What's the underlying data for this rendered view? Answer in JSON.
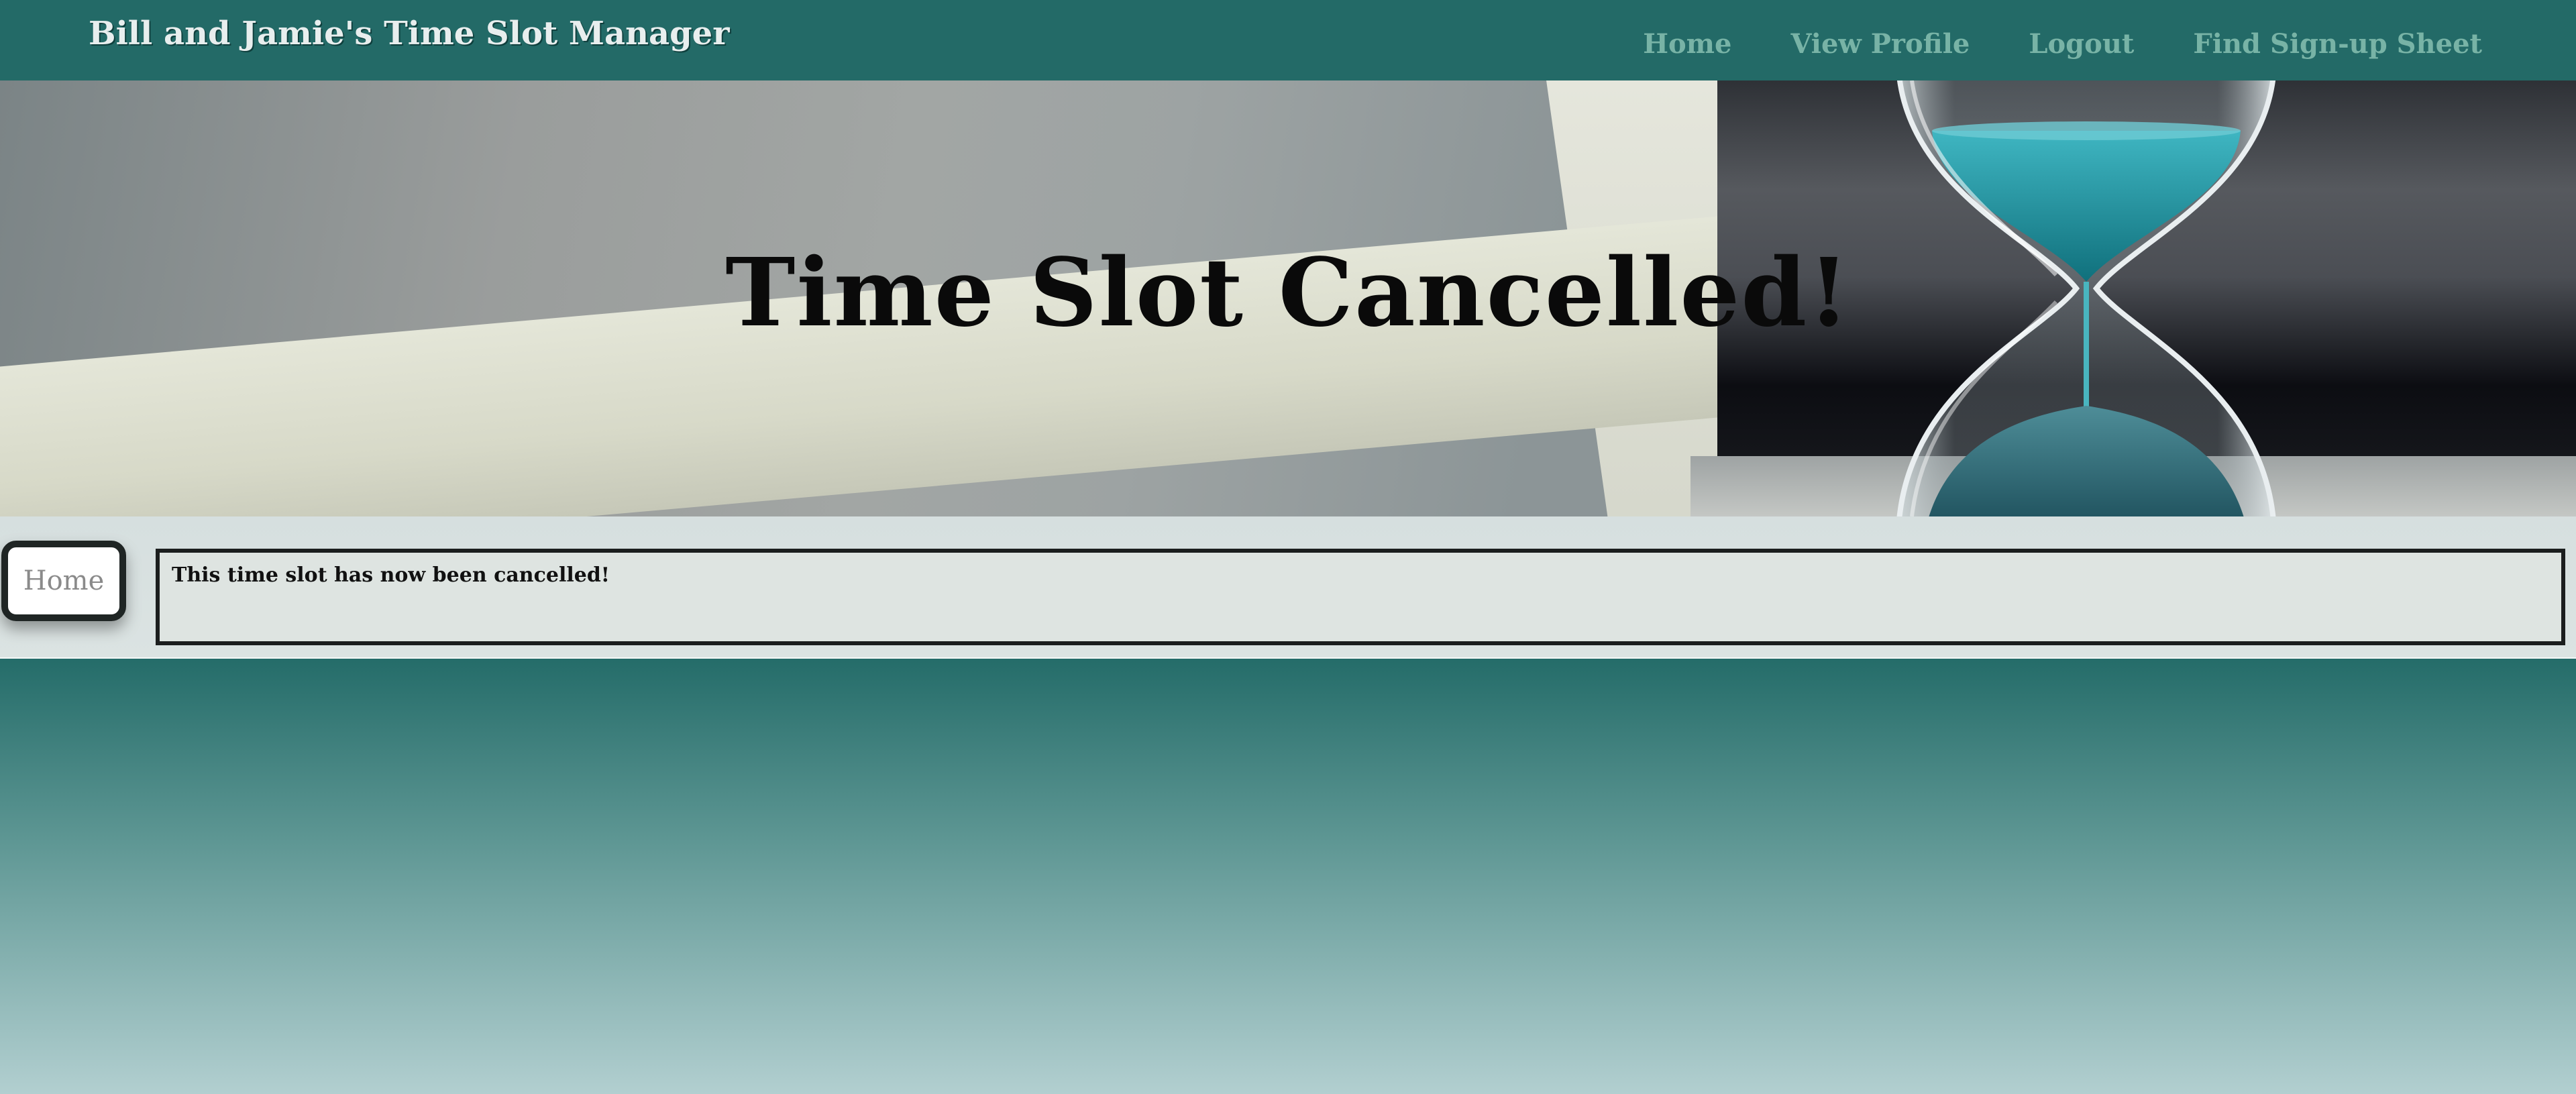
{
  "navbar": {
    "brand": "Bill and Jamie's Time Slot Manager",
    "links": [
      {
        "label": "Home"
      },
      {
        "label": "View Profile"
      },
      {
        "label": "Logout"
      },
      {
        "label": "Find Sign-up Sheet"
      }
    ]
  },
  "hero": {
    "title": "Time Slot Cancelled!"
  },
  "content": {
    "home_button_label": "Home",
    "message": "This time slot has now been cancelled!"
  },
  "colors": {
    "navbar_bg": "#236a67",
    "nav_link": "#78b3a6",
    "brand_text": "#e8eeee",
    "hourglass_sand": "#1e93a4"
  }
}
